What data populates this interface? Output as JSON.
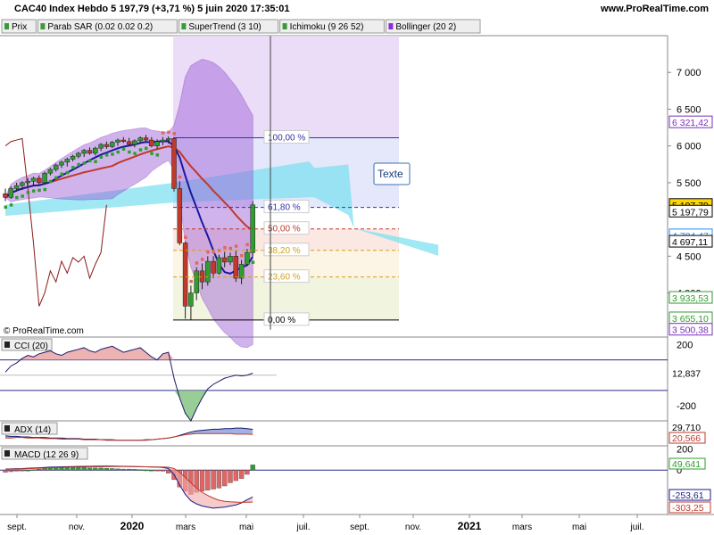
{
  "header": {
    "title": "CAC40 Index Hebdo 5 197,79 (+3,71 %) 5 juin 2020 17:35:01",
    "site": "www.ProRealTime.com"
  },
  "legend": [
    {
      "name": "Prix",
      "color": "#3a9a3a"
    },
    {
      "name": "Parab SAR (0.02 0.02 0.2)",
      "color": "#3a9a3a"
    },
    {
      "name": "SuperTrend (3 10)",
      "color": "#3a9a3a"
    },
    {
      "name": "Ichimoku (9 26 52)",
      "color": "#3a9a3a"
    },
    {
      "name": "Bollinger (20 2)",
      "color": "#8a2be2"
    }
  ],
  "watermark": "© ProRealTime.com",
  "texte_label": "Texte",
  "colors": {
    "bull": "#2e9e2e",
    "bear": "#c0392b",
    "bollinger_fill": "#9b59d6",
    "cloud_bull": "#7fe0f0",
    "cloud_bear": "#cde8a0"
  },
  "chart_data": [
    {
      "type": "candlestick",
      "panel": "price",
      "x_ticks": [
        "sept.",
        "nov.",
        "2020",
        "mars",
        "mai",
        "juil.",
        "sept.",
        "nov.",
        "2021",
        "mars",
        "mai",
        "juil."
      ],
      "x_ticks_bold": [
        "2020",
        "2021"
      ],
      "y_ticks": [
        7000,
        6500,
        6000,
        5500,
        4500,
        4000
      ],
      "y_tick_labels": [
        "7 000",
        "6 500",
        "6 000",
        "5 500",
        "4 500",
        "4 000"
      ],
      "ylim": [
        3400,
        7500
      ],
      "weeks_total": 98,
      "candles": [
        [
          5350,
          5420,
          5250,
          5300
        ],
        [
          5300,
          5450,
          5280,
          5420
        ],
        [
          5420,
          5500,
          5380,
          5460
        ],
        [
          5460,
          5520,
          5400,
          5500
        ],
        [
          5500,
          5560,
          5450,
          5520
        ],
        [
          5520,
          5580,
          5470,
          5560
        ],
        [
          5560,
          5600,
          5480,
          5500
        ],
        [
          5500,
          5650,
          5490,
          5630
        ],
        [
          5630,
          5700,
          5600,
          5680
        ],
        [
          5680,
          5760,
          5650,
          5740
        ],
        [
          5740,
          5800,
          5700,
          5780
        ],
        [
          5780,
          5840,
          5720,
          5820
        ],
        [
          5820,
          5880,
          5790,
          5860
        ],
        [
          5860,
          5920,
          5830,
          5900
        ],
        [
          5900,
          5960,
          5850,
          5940
        ],
        [
          5940,
          5980,
          5880,
          5900
        ],
        [
          5900,
          5990,
          5870,
          5970
        ],
        [
          5970,
          6040,
          5930,
          6020
        ],
        [
          6020,
          6060,
          5960,
          5990
        ],
        [
          5990,
          6070,
          5970,
          6050
        ],
        [
          6050,
          6100,
          6000,
          6080
        ],
        [
          6080,
          6120,
          6040,
          6060
        ],
        [
          6060,
          6110,
          6000,
          6020
        ],
        [
          6020,
          6090,
          5980,
          6070
        ],
        [
          6070,
          6130,
          6030,
          6110
        ],
        [
          6110,
          6150,
          6050,
          6080
        ],
        [
          6080,
          6120,
          5980,
          6000
        ],
        [
          6000,
          6090,
          5960,
          6060
        ],
        [
          6060,
          6120,
          6010,
          6080
        ],
        [
          6080,
          6130,
          6030,
          6100
        ],
        [
          6100,
          6110,
          5380,
          5420
        ],
        [
          5420,
          5520,
          4650,
          4680
        ],
        [
          4680,
          4700,
          3650,
          3820
        ],
        [
          3820,
          4100,
          3630,
          4000
        ],
        [
          4000,
          4350,
          3900,
          4300
        ],
        [
          4300,
          4400,
          4050,
          4150
        ],
        [
          4150,
          4500,
          4100,
          4430
        ],
        [
          4430,
          4500,
          4200,
          4270
        ],
        [
          4270,
          4520,
          4250,
          4480
        ],
        [
          4480,
          4560,
          4350,
          4420
        ],
        [
          4420,
          4550,
          4380,
          4500
        ],
        [
          4500,
          4580,
          4150,
          4200
        ],
        [
          4200,
          4450,
          4120,
          4390
        ],
        [
          4390,
          4600,
          4370,
          4550
        ],
        [
          4550,
          5250,
          4500,
          5198
        ]
      ],
      "right_labels": [
        {
          "text": "6 321,42",
          "value": 6321.42,
          "color": "#7b2cbf",
          "bg": "#ffffff"
        },
        {
          "text": "5 197,79",
          "value": 5197.79,
          "color": "#000000",
          "bg": "#ffd700"
        },
        {
          "text": "5 197,79",
          "value": 5107,
          "color": "#000000",
          "bg": "#ffffff"
        },
        {
          "text": "4 784,47",
          "value": 4784.47,
          "color": "#1e90ff",
          "bg": "#ffffff"
        },
        {
          "text": "4 697,11",
          "value": 4697.11,
          "color": "#000000",
          "bg": "#ffffff"
        },
        {
          "text": "3 933,53",
          "value": 3933.53,
          "color": "#2e9e2e",
          "bg": "#ffffff"
        },
        {
          "text": "3 655,10",
          "value": 3655.1,
          "color": "#2e9e2e",
          "bg": "#ffffff"
        },
        {
          "text": "3 500,38",
          "value": 3500.38,
          "color": "#7b2cbf",
          "bg": "#ffffff"
        }
      ],
      "fibonacci": {
        "high": 6111,
        "low": 3632,
        "levels": [
          {
            "label": "100,00 %",
            "ratio": 1.0
          },
          {
            "label": "61,80 %",
            "ratio": 0.618
          },
          {
            "label": "50,00 %",
            "ratio": 0.5
          },
          {
            "label": "38,20 %",
            "ratio": 0.382
          },
          {
            "label": "23,60 %",
            "ratio": 0.236
          },
          {
            "label": "0,00 %",
            "ratio": 0.0
          }
        ]
      }
    },
    {
      "type": "line",
      "panel": "cci",
      "title": "CCI (20)",
      "y_ticks": [
        200,
        -200
      ],
      "y_tick_labels": [
        "200",
        "-200"
      ],
      "value_label": "12,837",
      "ylim": [
        -300,
        250
      ],
      "values": [
        20,
        60,
        80,
        110,
        130,
        120,
        140,
        150,
        160,
        140,
        130,
        150,
        160,
        170,
        180,
        160,
        150,
        170,
        180,
        190,
        170,
        150,
        160,
        170,
        180,
        150,
        120,
        100,
        140,
        150,
        -20,
        -150,
        -250,
        -300,
        -220,
        -150,
        -90,
        -60,
        -40,
        -20,
        -10,
        0,
        -5,
        0,
        12.837
      ]
    },
    {
      "type": "line",
      "panel": "adx",
      "title": "ADX (14)",
      "value_labels": [
        "29,710",
        "20,566"
      ],
      "ylim": [
        0,
        45
      ],
      "adx": [
        18,
        17,
        17,
        16,
        16,
        15,
        15,
        15,
        14,
        14,
        14,
        13,
        13,
        13,
        12,
        12,
        12,
        11,
        11,
        11,
        10,
        10,
        10,
        10,
        10,
        11,
        11,
        12,
        13,
        14,
        16,
        19,
        22,
        25,
        27,
        28,
        29,
        30,
        30,
        31,
        31,
        32,
        32,
        31,
        29.71
      ],
      "di": [
        14,
        14,
        15,
        15,
        14,
        14,
        14,
        13,
        13,
        13,
        12,
        12,
        12,
        12,
        11,
        11,
        11,
        11,
        10,
        10,
        10,
        10,
        10,
        10,
        10,
        10,
        11,
        12,
        13,
        14,
        16,
        18,
        20,
        21,
        22,
        22,
        22,
        22,
        22,
        22,
        22,
        21,
        21,
        21,
        20.566
      ]
    },
    {
      "type": "bar",
      "panel": "macd",
      "title": "MACD (12 26 9)",
      "y_ticks": [
        200,
        0
      ],
      "y_tick_labels": [
        "200",
        "0"
      ],
      "value_labels": [
        "49,641",
        "-253,61",
        "-303,25"
      ],
      "ylim": [
        -420,
        230
      ],
      "histogram": [
        -20,
        -15,
        -10,
        -5,
        0,
        5,
        10,
        15,
        20,
        25,
        30,
        30,
        28,
        25,
        25,
        22,
        20,
        20,
        18,
        15,
        12,
        10,
        10,
        8,
        5,
        2,
        0,
        -5,
        -10,
        -30,
        -90,
        -160,
        -200,
        -230,
        -210,
        -200,
        -190,
        -180,
        -170,
        -150,
        -120,
        -100,
        -80,
        -40,
        49.641
      ],
      "macd": [
        10,
        12,
        14,
        15,
        18,
        20,
        22,
        25,
        28,
        30,
        32,
        33,
        34,
        35,
        36,
        36,
        37,
        38,
        38,
        38,
        37,
        36,
        35,
        34,
        33,
        32,
        30,
        28,
        25,
        15,
        -40,
        -140,
        -230,
        -290,
        -320,
        -340,
        -350,
        -360,
        -355,
        -350,
        -340,
        -330,
        -310,
        -280,
        -253.61
      ],
      "signal": [
        8,
        9,
        10,
        12,
        14,
        16,
        18,
        20,
        22,
        24,
        26,
        28,
        29,
        30,
        31,
        32,
        32,
        33,
        33,
        34,
        34,
        34,
        34,
        33,
        33,
        32,
        31,
        30,
        29,
        27,
        15,
        -20,
        -70,
        -120,
        -170,
        -210,
        -240,
        -265,
        -285,
        -295,
        -300,
        -303,
        -305,
        -304,
        -303.25
      ]
    }
  ]
}
